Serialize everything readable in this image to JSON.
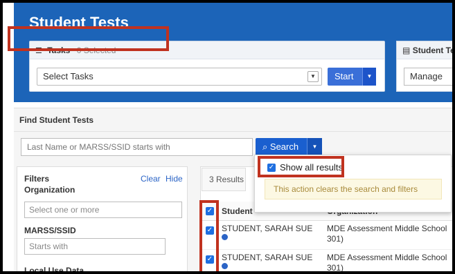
{
  "header": {
    "title": "Student Tests"
  },
  "tasks": {
    "label": "Tasks",
    "selected_count": "0 Selected",
    "select_value": "Select Tasks",
    "start_label": "Start",
    "panel_icon": "list-icon"
  },
  "student_test_panel": {
    "label": "Student Tes",
    "select_value": "Manage"
  },
  "find": {
    "heading": "Find Student Tests",
    "search_placeholder": "Last Name or MARSS/SSID starts with",
    "search_button": "Search"
  },
  "filters": {
    "title": "Filters",
    "clear": "Clear",
    "hide": "Hide",
    "organization_label": "Organization",
    "organization_placeholder": "Select one or more",
    "marss_label": "MARSS/SSID",
    "marss_placeholder": "Starts with",
    "local_use_label": "Local Use Data"
  },
  "results": {
    "count": "3 Results",
    "columns": {
      "student": "Student",
      "organization": "Organization"
    },
    "rows": [
      {
        "name": "STUDENT, SARAH SUE",
        "org": "MDE Assessment Middle School",
        "org2": "301)"
      },
      {
        "name": "STUDENT, SARAH SUE",
        "org": "MDE Assessment Middle School",
        "org2": "301)"
      }
    ]
  },
  "popup": {
    "show_all": "Show all results",
    "warning": "This action clears the search and filters"
  },
  "colors": {
    "brand_blue": "#1c64b8",
    "button_blue": "#1a5fcf",
    "highlight_red": "#c0321f"
  }
}
